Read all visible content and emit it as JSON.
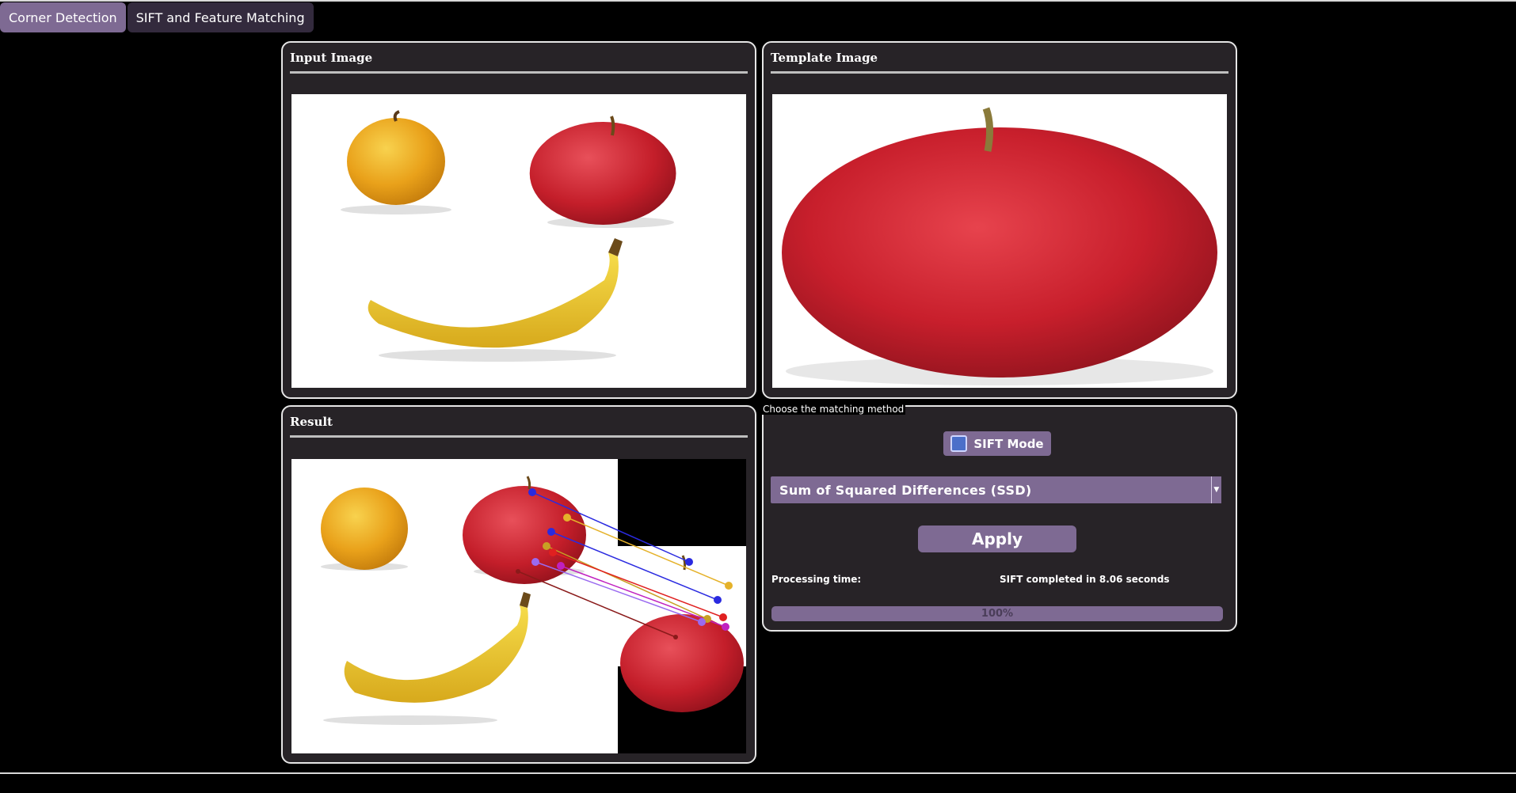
{
  "tabs": [
    {
      "label": "Corner Detection",
      "active": true
    },
    {
      "label": "SIFT and Feature Matching",
      "active": false
    }
  ],
  "panels": {
    "input": {
      "title": "Input Image"
    },
    "template": {
      "title": "Template Image"
    },
    "result": {
      "title": "Result"
    }
  },
  "controls": {
    "legend": "Choose the matching method",
    "sift_mode_label": "SIFT Mode",
    "sift_mode_checked": false,
    "method_selected": "Sum of Squared Differences (SSD)",
    "apply_label": "Apply",
    "processing_label": "Processing time:",
    "processing_value": "SIFT completed in 8.06 seconds",
    "progress_value": 100,
    "progress_text": "100%"
  },
  "colors": {
    "accent": "#7e6a93",
    "panel_bg": "#272327",
    "tab_inactive": "#332a3d"
  }
}
